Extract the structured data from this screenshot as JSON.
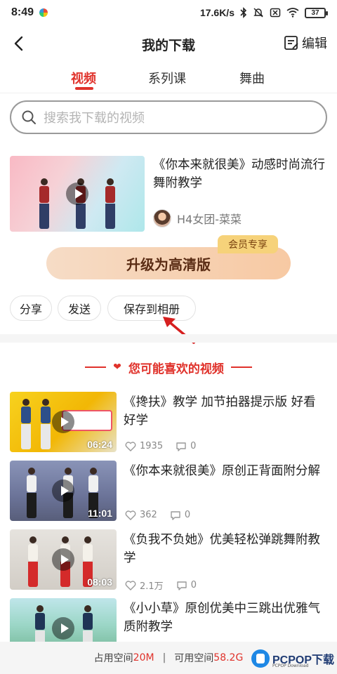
{
  "status_bar": {
    "time": "8:49",
    "network_speed": "17.6K/s",
    "battery": "37"
  },
  "nav": {
    "title": "我的下载",
    "edit_label": "编辑"
  },
  "tabs": [
    {
      "label": "视频",
      "active": true
    },
    {
      "label": "系列课",
      "active": false
    },
    {
      "label": "舞曲",
      "active": false
    }
  ],
  "search": {
    "placeholder": "搜索我下载的视频"
  },
  "download": {
    "title": "《你本来就很美》动感时尚流行舞附教学",
    "author": "H4女团-菜菜",
    "upgrade_label": "升级为高清版",
    "vip_badge": "会员专享",
    "actions": [
      "分享",
      "发送",
      "保存到相册"
    ]
  },
  "recommend": {
    "heading": "您可能喜欢的视频",
    "items": [
      {
        "title": "《搀扶》教学 加节拍器提示版 好看好学",
        "duration": "06:24",
        "likes": "1935",
        "comments": "0"
      },
      {
        "title": "《你本来就很美》原创正背面附分解",
        "duration": "11:01",
        "likes": "362",
        "comments": "0"
      },
      {
        "title": "《负我不负她》优美轻松弹跳舞附教学",
        "duration": "08:03",
        "likes": "2.1万",
        "comments": "0"
      },
      {
        "title": "《小小草》原创优美中三跳出优雅气质附教学",
        "duration": "",
        "likes": "",
        "comments": ""
      }
    ]
  },
  "storage": {
    "used_label": "占用空间",
    "used_value": "20M",
    "free_label": "可用空间",
    "free_value": "58.2G"
  },
  "watermark": {
    "text": "PCPOP下载",
    "sub": "PCPOP Download"
  },
  "colors": {
    "accent": "#e0322b",
    "upgrade_text": "#5a2c14",
    "vip_badge": "#f6d27a"
  }
}
